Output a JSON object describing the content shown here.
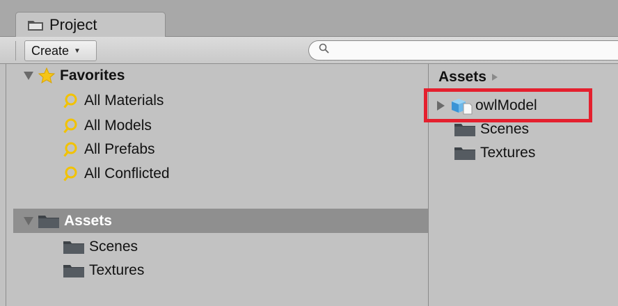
{
  "tab": {
    "label": "Project",
    "icon": "folder-icon"
  },
  "toolbar": {
    "create_label": "Create",
    "create_caret": "▼",
    "search_value": "",
    "search_icon": "search-icon"
  },
  "favorites": {
    "label": "Favorites",
    "items": [
      {
        "label": "All Materials",
        "icon": "search-icon"
      },
      {
        "label": "All Models",
        "icon": "search-icon"
      },
      {
        "label": "All Prefabs",
        "icon": "search-icon"
      },
      {
        "label": "All Conflicted",
        "icon": "search-icon"
      }
    ]
  },
  "tree": {
    "assets_label": "Assets",
    "children": [
      {
        "label": "Scenes",
        "icon": "folder-icon"
      },
      {
        "label": "Textures",
        "icon": "folder-icon"
      }
    ]
  },
  "content": {
    "breadcrumb": "Assets",
    "items": [
      {
        "label": "owlModel",
        "icon": "model-prefab-icon",
        "expandable": true,
        "highlighted": true
      },
      {
        "label": "Scenes",
        "icon": "folder-icon"
      },
      {
        "label": "Textures",
        "icon": "folder-icon"
      }
    ]
  },
  "colors": {
    "highlight_box": "#e4202e",
    "selected_row": "#8f8f8f",
    "panel_bg": "#c2c2c2",
    "tab_bar": "#a8a8a8"
  }
}
